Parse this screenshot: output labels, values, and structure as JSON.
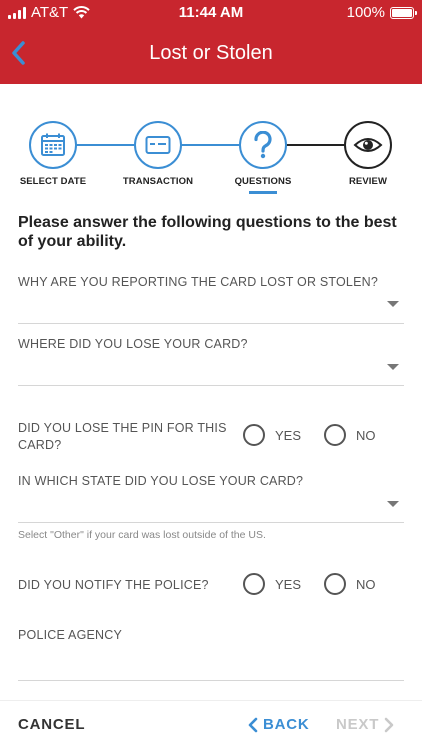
{
  "status_bar": {
    "carrier": "AT&T",
    "time": "11:44 AM",
    "battery": "100%"
  },
  "header": {
    "title": "Lost or Stolen",
    "background_color": "#c8262e"
  },
  "stepper": {
    "steps": [
      {
        "label": "SELECT DATE",
        "icon": "calendar-icon",
        "state": "complete"
      },
      {
        "label": "TRANSACTION",
        "icon": "credit-card-icon",
        "state": "complete"
      },
      {
        "label": "QUESTIONS",
        "icon": "question-mark-icon",
        "state": "current"
      },
      {
        "label": "REVIEW",
        "icon": "eye-icon",
        "state": "upcoming"
      }
    ],
    "accent_color": "#3b8ed4"
  },
  "form": {
    "heading": "Please answer the following questions to the best of your ability.",
    "q_reason": {
      "label": "WHY ARE YOU REPORTING THE CARD LOST OR STOLEN?",
      "value": ""
    },
    "q_where": {
      "label": "WHERE DID YOU LOSE YOUR CARD?",
      "value": ""
    },
    "q_pin": {
      "label": "DID YOU LOSE THE PIN FOR THIS CARD?",
      "yes": "YES",
      "no": "NO"
    },
    "q_state": {
      "label": "IN WHICH STATE DID YOU LOSE YOUR CARD?",
      "value": "",
      "helper": "Select \"Other\" if your card was lost outside of the US."
    },
    "q_police": {
      "label": "DID YOU NOTIFY THE POLICE?",
      "yes": "YES",
      "no": "NO"
    },
    "q_agency": {
      "label": "POLICE AGENCY",
      "value": ""
    }
  },
  "footer": {
    "cancel": "CANCEL",
    "back": "BACK",
    "next": "NEXT"
  }
}
